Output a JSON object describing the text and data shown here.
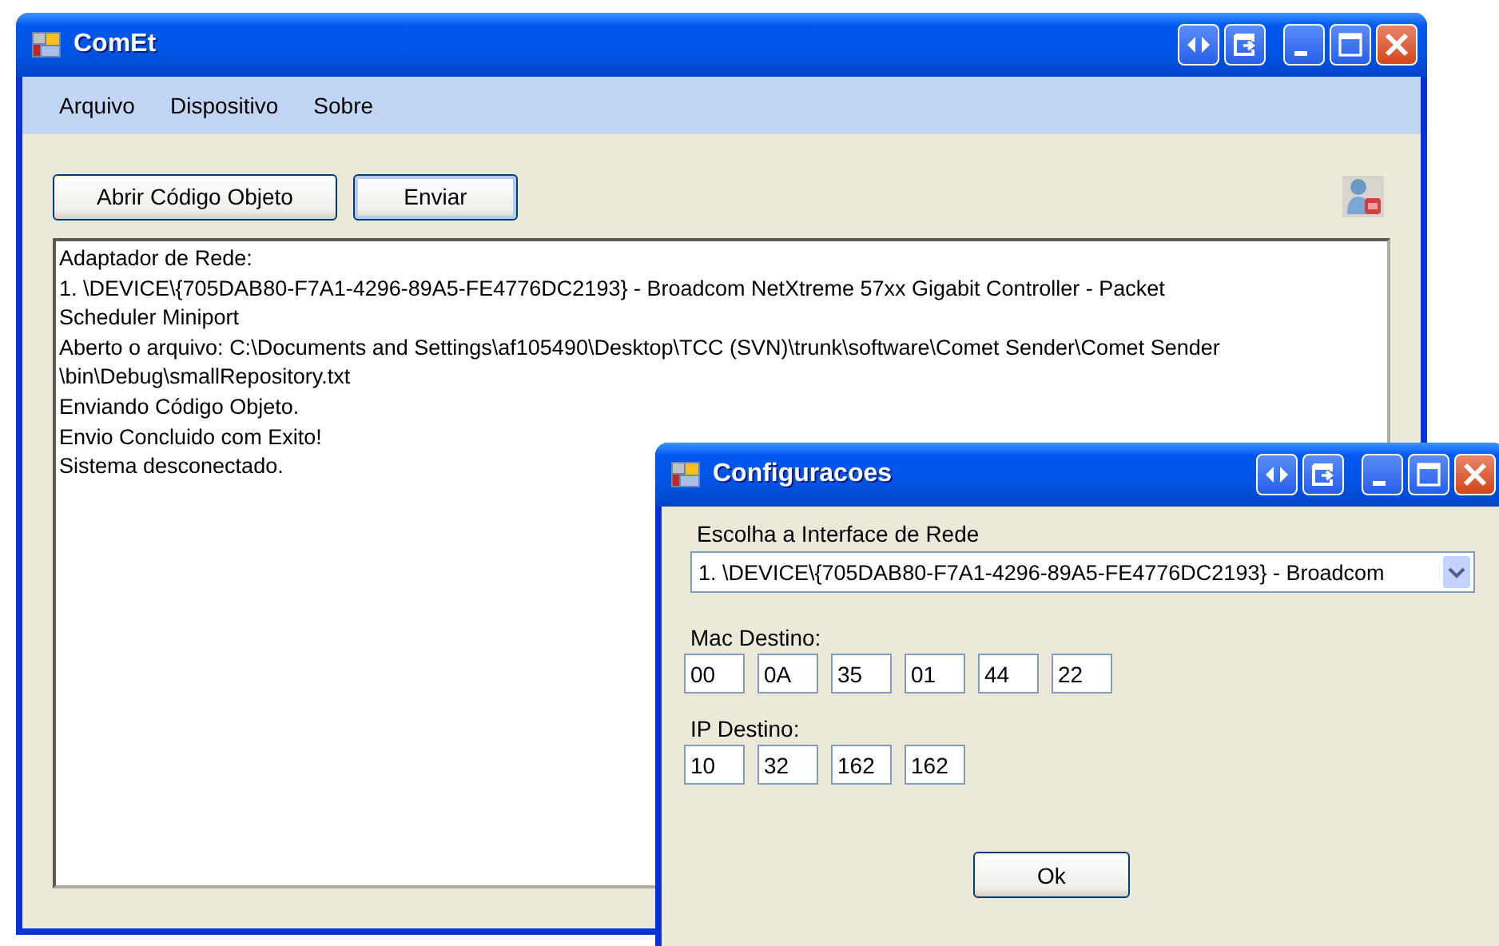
{
  "main_window": {
    "title": "ComEt",
    "menu": [
      "Arquivo",
      "Dispositivo",
      "Sobre"
    ],
    "buttons": [
      {
        "label": "Abrir Código Objeto",
        "default": false
      },
      {
        "label": "Enviar",
        "default": true
      }
    ],
    "log": [
      "Adaptador de Rede:",
      "1. \\DEVICE\\{705DAB80-F7A1-4296-89A5-FE4776DC2193} - Broadcom NetXtreme 57xx Gigabit Controller - Packet",
      "Scheduler Miniport",
      "Aberto o arquivo: C:\\Documents and Settings\\af105490\\Desktop\\TCC (SVN)\\trunk\\software\\Comet Sender\\Comet Sender",
      "\\bin\\Debug\\smallRepository.txt",
      "Enviando Código Objeto.",
      "Envio Concluido com Exito!",
      "Sistema desconectado."
    ]
  },
  "dialog": {
    "title": "Configuracoes",
    "interface_label": "Escolha a Interface de Rede",
    "interface_value": "1. \\DEVICE\\{705DAB80-F7A1-4296-89A5-FE4776DC2193} - Broadcom",
    "mac_label": "Mac Destino:",
    "mac": [
      "00",
      "0A",
      "35",
      "01",
      "44",
      "22"
    ],
    "ip_label": "IP Destino:",
    "ip": [
      "10",
      "32",
      "162",
      "162"
    ],
    "ok": "Ok"
  }
}
